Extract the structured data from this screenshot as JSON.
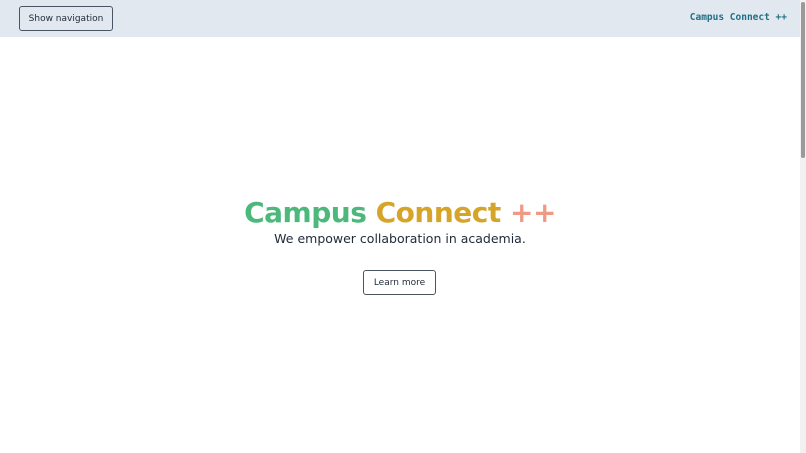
{
  "header": {
    "nav_button_label": "Show navigation",
    "brand": "Campus Connect ++"
  },
  "hero": {
    "title_part1": "Campus",
    "title_part2": "Connect",
    "title_part3": "++",
    "subtitle": "We empower collaboration in academia.",
    "cta_label": "Learn more"
  },
  "colors": {
    "header_bg": "#e2e8f0",
    "brand_text": "#1f6f86",
    "title_green": "#4cb87c",
    "title_gold": "#d6a428",
    "title_salmon": "#f09a86"
  }
}
